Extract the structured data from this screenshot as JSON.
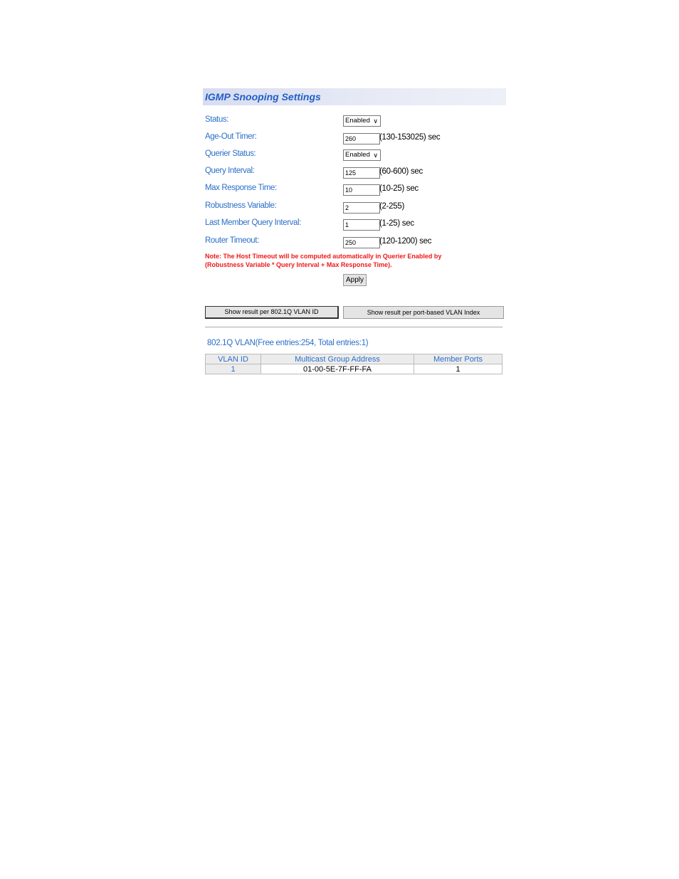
{
  "title": "IGMP Snooping Settings",
  "fields": [
    {
      "label": "Status:",
      "type": "select",
      "value": "Enabled",
      "range": ""
    },
    {
      "label": "Age-Out Timer:",
      "type": "input",
      "value": "260",
      "range": "(130-153025) sec"
    },
    {
      "label": "Querier Status:",
      "type": "select",
      "value": "Enabled",
      "range": ""
    },
    {
      "label": "Query Interval:",
      "type": "input",
      "value": "125",
      "range": "(60-600) sec"
    },
    {
      "label": "Max Response Time:",
      "type": "input",
      "value": "10",
      "range": "(10-25) sec"
    },
    {
      "label": "Robustness Variable:",
      "type": "input",
      "value": "2",
      "range": "(2-255)"
    },
    {
      "label": "Last Member Query Interval:",
      "type": "input",
      "value": "1",
      "range": "(1-25) sec"
    },
    {
      "label": "Router Timeout:",
      "type": "input",
      "value": "250",
      "range": "(120-1200) sec"
    }
  ],
  "note": [
    "Note: The Host Timeout will be computed automatically in Querier Enabled by",
    "(Robustness Variable * Query Interval + Max Response Time)."
  ],
  "apply_label": "Apply",
  "show_vlan_id_label": "Show result per 802.1Q VLAN ID",
  "show_port_based_label": "Show result  per port-based VLAN Index",
  "vlan_summary": "802.1Q VLAN(Free entries:254, Total entries:1)",
  "table": {
    "headers": [
      "VLAN ID",
      "Multicast Group Address",
      "Member Ports"
    ],
    "rows": [
      [
        "1",
        "01-00-5E-7F-FF-FA",
        "1"
      ]
    ]
  },
  "colors": {
    "label": "#2a6fc9",
    "note": "#f01818",
    "title": "#1f5fc8"
  }
}
